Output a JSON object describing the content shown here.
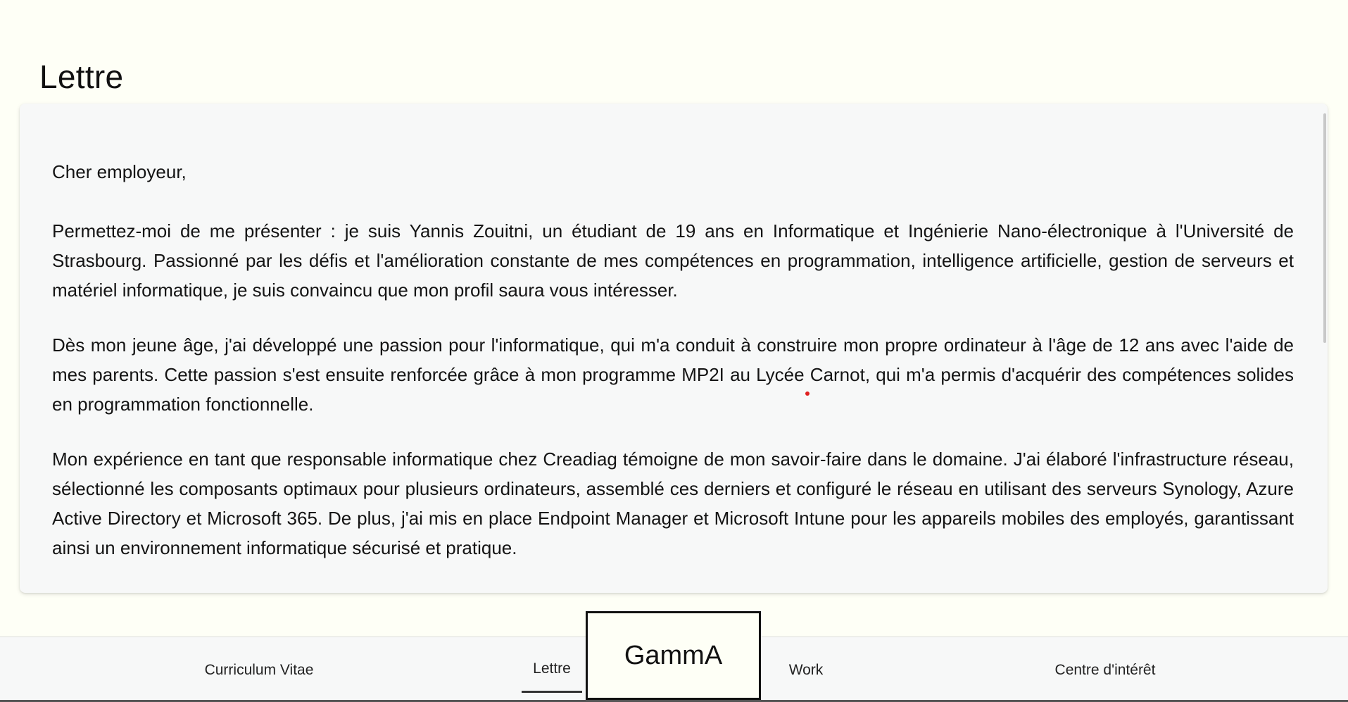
{
  "page": {
    "title": "Lettre"
  },
  "letter": {
    "greeting": "Cher employeur,",
    "paragraphs": [
      "Permettez-moi de me présenter : je suis Yannis Zouitni, un étudiant de 19 ans en Informatique et Ingénierie Nano-électronique à l'Université de Strasbourg. Passionné par les défis et l'amélioration constante de mes compétences en programmation, intelligence artificielle, gestion de serveurs et matériel informatique, je suis convaincu que mon profil saura vous intéresser.",
      "Dès mon jeune âge, j'ai développé une passion pour l'informatique, qui m'a conduit à construire mon propre ordinateur à l'âge de 12 ans avec l'aide de mes parents. Cette passion s'est ensuite renforcée grâce à mon programme MP2I au Lycée Carnot, qui m'a permis d'acquérir des compétences solides en programmation fonctionnelle.",
      "Mon expérience en tant que responsable informatique chez Creadiag témoigne de mon savoir-faire dans le domaine. J'ai élaboré l'infrastructure réseau, sélectionné les composants optimaux pour plusieurs ordinateurs, assemblé ces derniers et configuré le réseau en utilisant des serveurs Synology, Azure Active Directory et Microsoft 365. De plus, j'ai mis en place Endpoint Manager et Microsoft Intune pour les appareils mobiles des employés, garantissant ainsi un environnement informatique sécurisé et pratique."
    ]
  },
  "nav": {
    "items": [
      {
        "label": "Curriculum Vitae",
        "active": false
      },
      {
        "label": "Lettre",
        "active": true
      },
      {
        "label": "Work",
        "active": false
      },
      {
        "label": "Centre d'intérêt",
        "active": false
      }
    ],
    "brand": "GammA"
  },
  "colors": {
    "background": "#fefff6",
    "card": "#f7f8f8",
    "text": "#141414",
    "cursor_dot": "#e02020"
  }
}
